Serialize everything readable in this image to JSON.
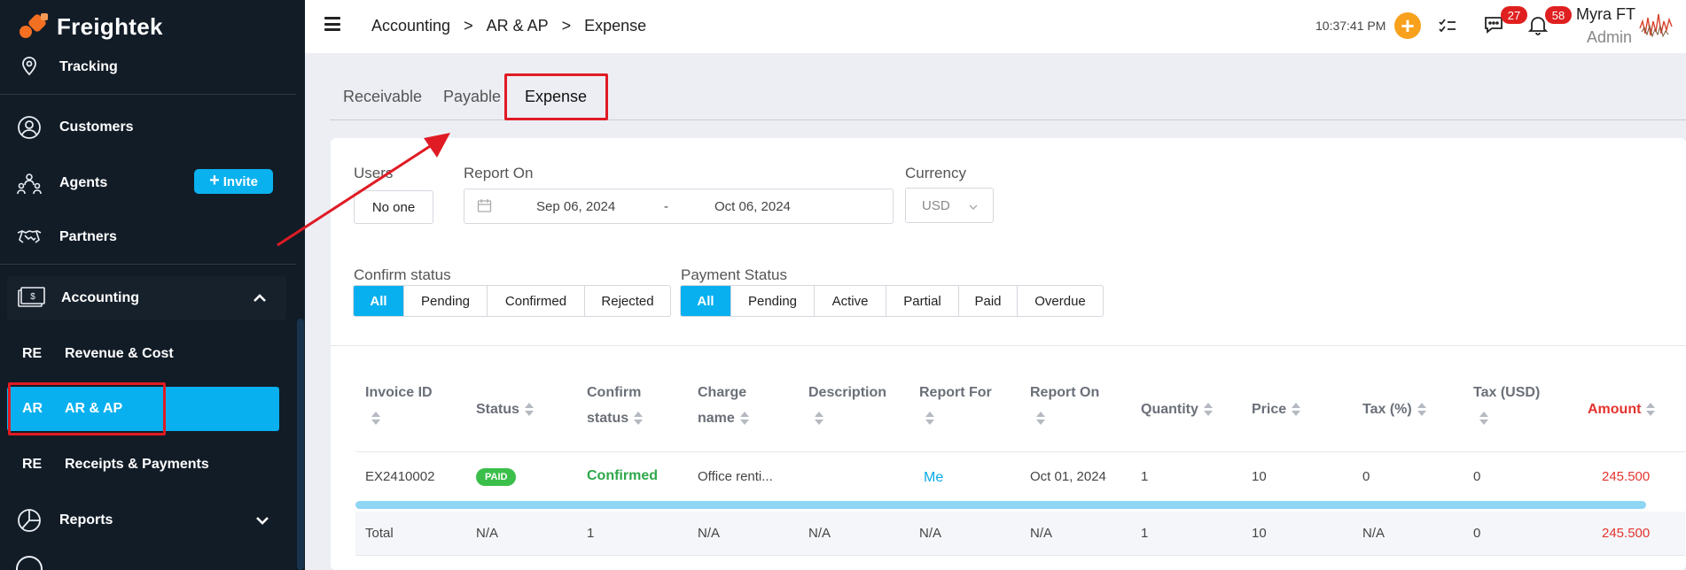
{
  "app": {
    "name": "Freightek"
  },
  "sidebar": {
    "items": [
      {
        "label": "Tracking",
        "icon": "map-pin-icon"
      },
      {
        "label": "Customers",
        "icon": "user-circle-icon"
      },
      {
        "label": "Agents",
        "icon": "agents-icon",
        "action": "Invite"
      },
      {
        "label": "Partners",
        "icon": "handshake-icon"
      },
      {
        "label": "Accounting",
        "icon": "money-icon",
        "expanded": true
      },
      {
        "label": "Reports",
        "icon": "pie-chart-icon"
      }
    ],
    "accounting_sub": [
      {
        "code": "RE",
        "label": "Revenue & Cost"
      },
      {
        "code": "AR",
        "label": "AR & AP",
        "active": true
      },
      {
        "code": "RE",
        "label": "Receipts & Payments"
      }
    ]
  },
  "header": {
    "breadcrumb": [
      "Accounting",
      "AR & AP",
      "Expense"
    ],
    "separator": ">",
    "time": "10:37:41 PM",
    "messages_count": "27",
    "notifications_count": "58",
    "user_name": "Myra FT",
    "user_role": "Admin"
  },
  "tabs": [
    "Receivable",
    "Payable",
    "Expense"
  ],
  "active_tab": "Expense",
  "filters": {
    "users_label": "Users",
    "users_value": "No one",
    "report_on_label": "Report On",
    "date_from": "Sep 06, 2024",
    "date_sep": "-",
    "date_to": "Oct 06, 2024",
    "currency_label": "Currency",
    "currency_value": "USD",
    "confirm_status_label": "Confirm status",
    "confirm_status_options": [
      "All",
      "Pending",
      "Confirmed",
      "Rejected"
    ],
    "payment_status_label": "Payment Status",
    "payment_status_options": [
      "All",
      "Pending",
      "Active",
      "Partial",
      "Paid",
      "Overdue"
    ]
  },
  "table": {
    "columns": [
      "Invoice ID",
      "Status",
      "Confirm status",
      "Charge name",
      "Description",
      "Report For",
      "Report On",
      "Quantity",
      "Price",
      "Tax (%)",
      "Tax (USD)",
      "Amount"
    ],
    "rows": [
      {
        "invoice_id": "EX2410002",
        "status": "PAID",
        "confirm_status": "Confirmed",
        "charge_name": "Office renti...",
        "description": "",
        "report_for": "Me",
        "report_on": "Oct 01, 2024",
        "quantity": "1",
        "price": "10",
        "tax_pct": "0",
        "tax_usd": "0",
        "amount": "245.500"
      }
    ],
    "total": {
      "label": "Total",
      "status": "N/A",
      "confirm_status": "1",
      "charge_name": "N/A",
      "description": "N/A",
      "report_for": "N/A",
      "report_on": "N/A",
      "quantity": "1",
      "price": "10",
      "tax_pct": "N/A",
      "tax_usd": "0",
      "amount": "245.500"
    }
  },
  "colors": {
    "sidebar_bg": "#121c27",
    "accent": "#08b0ef",
    "annotation": "#e01b24",
    "amount": "#e3342f",
    "confirmed": "#2ea84a"
  }
}
